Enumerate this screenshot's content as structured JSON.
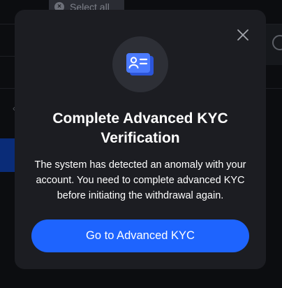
{
  "background": {
    "select_all_label": "Select all",
    "clear_icon_glyph": "×"
  },
  "modal": {
    "icon": "id-card-icon",
    "title": "Complete Advanced KYC Verification",
    "description": "The system has detected an anomaly with your account. You need to complete advanced KYC before initiating the withdrawal again.",
    "button_label": "Go to Advanced KYC",
    "close_icon": "close-icon"
  },
  "colors": {
    "modal_bg": "#1c1d22",
    "accent": "#1e64fe",
    "icon_circle": "#2d2f36"
  }
}
